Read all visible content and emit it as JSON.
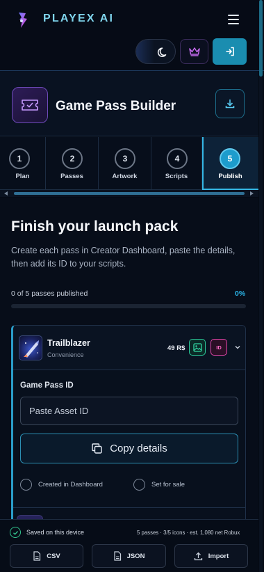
{
  "app": {
    "brand": "PLAYEX AI"
  },
  "header": {
    "menu_icon": "hamburger-menu-icon",
    "theme_icon": "moon-icon",
    "premium_icon": "crown-icon",
    "login_icon": "sign-in-icon"
  },
  "builder": {
    "title": "Game Pass Builder",
    "icon": "ticket-icon",
    "download_icon": "download-icon"
  },
  "steps": [
    {
      "number": "1",
      "label": "Plan"
    },
    {
      "number": "2",
      "label": "Passes"
    },
    {
      "number": "3",
      "label": "Artwork"
    },
    {
      "number": "4",
      "label": "Scripts"
    },
    {
      "number": "5",
      "label": "Publish",
      "active": true
    }
  ],
  "main": {
    "heading": "Finish your launch pack",
    "description": "Create each pass in Creator Dashboard, paste the details, then add its ID to your scripts.",
    "progress": {
      "text": "0 of 5 passes published",
      "percent_label": "0%",
      "value": 0
    }
  },
  "pass": {
    "name": "Trailblazer",
    "category": "Convenience",
    "price": "49 R$",
    "image_icon": "image-icon",
    "id_badge": "ID",
    "field_label": "Game Pass ID",
    "input_value": "",
    "input_placeholder": "Paste Asset ID",
    "copy_label": "Copy details",
    "check_created": "Created in Dashboard",
    "check_sale": "Set for sale"
  },
  "footer": {
    "saved": "Saved on this device",
    "summary": "5 passes · 3/5 icons · est. 1,080 net Robux",
    "buttons": {
      "csv": "CSV",
      "json": "JSON",
      "import": "Import"
    }
  },
  "colors": {
    "accent": "#2ab3e6",
    "background": "#070d19",
    "brand": "#7fd4ec",
    "purple": "#6d4ab8",
    "pink": "#e046a8",
    "green": "#2bc99a"
  }
}
